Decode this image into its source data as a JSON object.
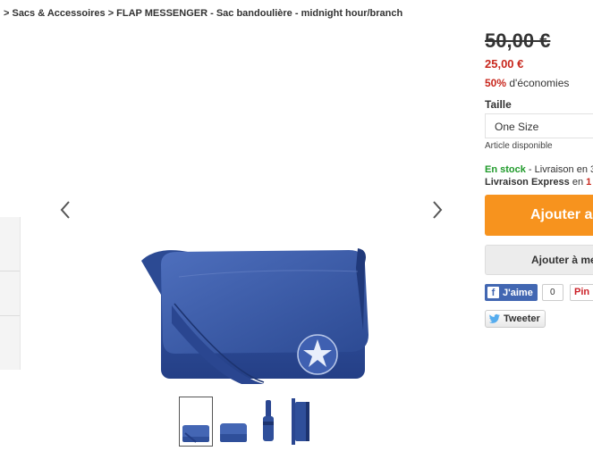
{
  "breadcrumb": "> Sacs & Accessoires > FLAP MESSENGER - Sac bandoulière - midnight hour/branch",
  "product": {
    "price_old": "50,00 €",
    "price_new": "25,00 €",
    "savings_percent": "50%",
    "savings_text": " d'économies",
    "size_label": "Taille",
    "size_value": "One Size",
    "availability": "Article disponible",
    "stock_label": "En stock",
    "stock_text": " - Livraison en 3",
    "express_label": "Livraison Express",
    "express_text": " en ",
    "express_value": "1",
    "add_to_cart": "Ajouter a",
    "add_to_wishlist": "Ajouter à me"
  },
  "social": {
    "fb_like": "J'aime",
    "fb_count": "0",
    "pinterest": "Pin",
    "tweet": "Tweeter"
  },
  "colors": {
    "accent_orange": "#f7931e",
    "price_red": "#c8281e",
    "stock_green": "#1f9a2a",
    "bag_blue": "#2f4f9a"
  },
  "gallery": {
    "thumbnail_count": 4,
    "active_thumbnail": 1
  }
}
